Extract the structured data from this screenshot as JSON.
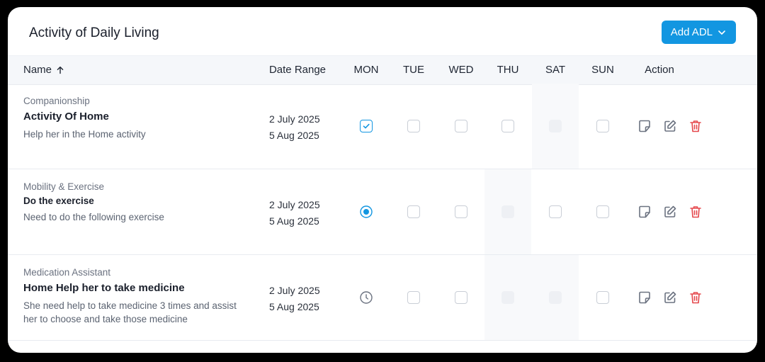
{
  "header": {
    "title": "Activity of Daily Living",
    "add_button_label": "Add ADL"
  },
  "columns": {
    "name": "Name",
    "date_range": "Date Range",
    "days": [
      "MON",
      "TUE",
      "WED",
      "THU",
      "SAT",
      "SUN"
    ],
    "action": "Action"
  },
  "rows": [
    {
      "category": "Companionship",
      "name": "Activity Of Home",
      "description": "Help her in the Home activity",
      "start_date": "2 July 2025",
      "end_date": "5 Aug 2025",
      "days": [
        "checked",
        "empty",
        "empty",
        "empty",
        "disabled",
        "empty"
      ]
    },
    {
      "category": "Mobility & Exercise",
      "name": "Do the exercise",
      "description": "Need to do the following exercise",
      "start_date": "2 July 2025",
      "end_date": "5 Aug 2025",
      "days": [
        "radio-selected",
        "empty",
        "empty",
        "disabled",
        "empty",
        "empty"
      ]
    },
    {
      "category": "Medication Assistant",
      "name": "Home Help her to take medicine",
      "description": "She need help to take medicine 3 times and assist her to choose and take those medicine",
      "start_date": "2 July 2025",
      "end_date": "5 Aug 2025",
      "days": [
        "pending-clock",
        "empty",
        "empty",
        "disabled",
        "disabled",
        "empty"
      ]
    }
  ],
  "colors": {
    "accent": "#1296e1",
    "delete": "#e5484d",
    "icon_gray": "#6b7280"
  },
  "icons": {
    "sort": "arrow-up-icon",
    "dropdown": "chevron-down-icon",
    "note": "note-icon",
    "edit": "edit-icon",
    "delete": "trash-icon",
    "pending": "clock-icon"
  }
}
